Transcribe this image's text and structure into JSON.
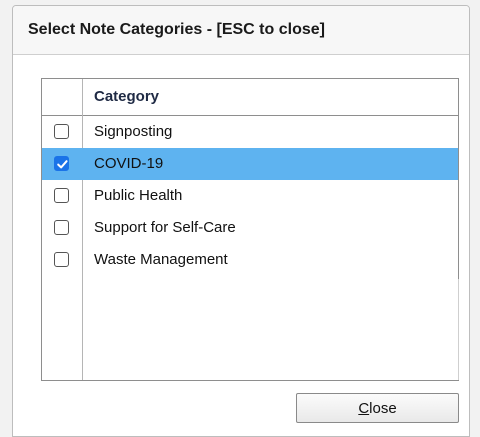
{
  "dialog": {
    "title": "Select Note Categories - [ESC to close]"
  },
  "grid": {
    "header": {
      "category": "Category"
    },
    "rows": [
      {
        "label": "Signposting",
        "checked": false,
        "selected": false
      },
      {
        "label": "COVID-19",
        "checked": true,
        "selected": true
      },
      {
        "label": "Public Health",
        "checked": false,
        "selected": false
      },
      {
        "label": "Support for Self-Care",
        "checked": false,
        "selected": false
      },
      {
        "label": "Waste Management",
        "checked": false,
        "selected": false
      }
    ]
  },
  "buttons": {
    "close_mnemonic": "C",
    "close_rest": "lose"
  },
  "colors": {
    "selection": "#5eb3f0",
    "checkbox_checked": "#1a73e8"
  }
}
